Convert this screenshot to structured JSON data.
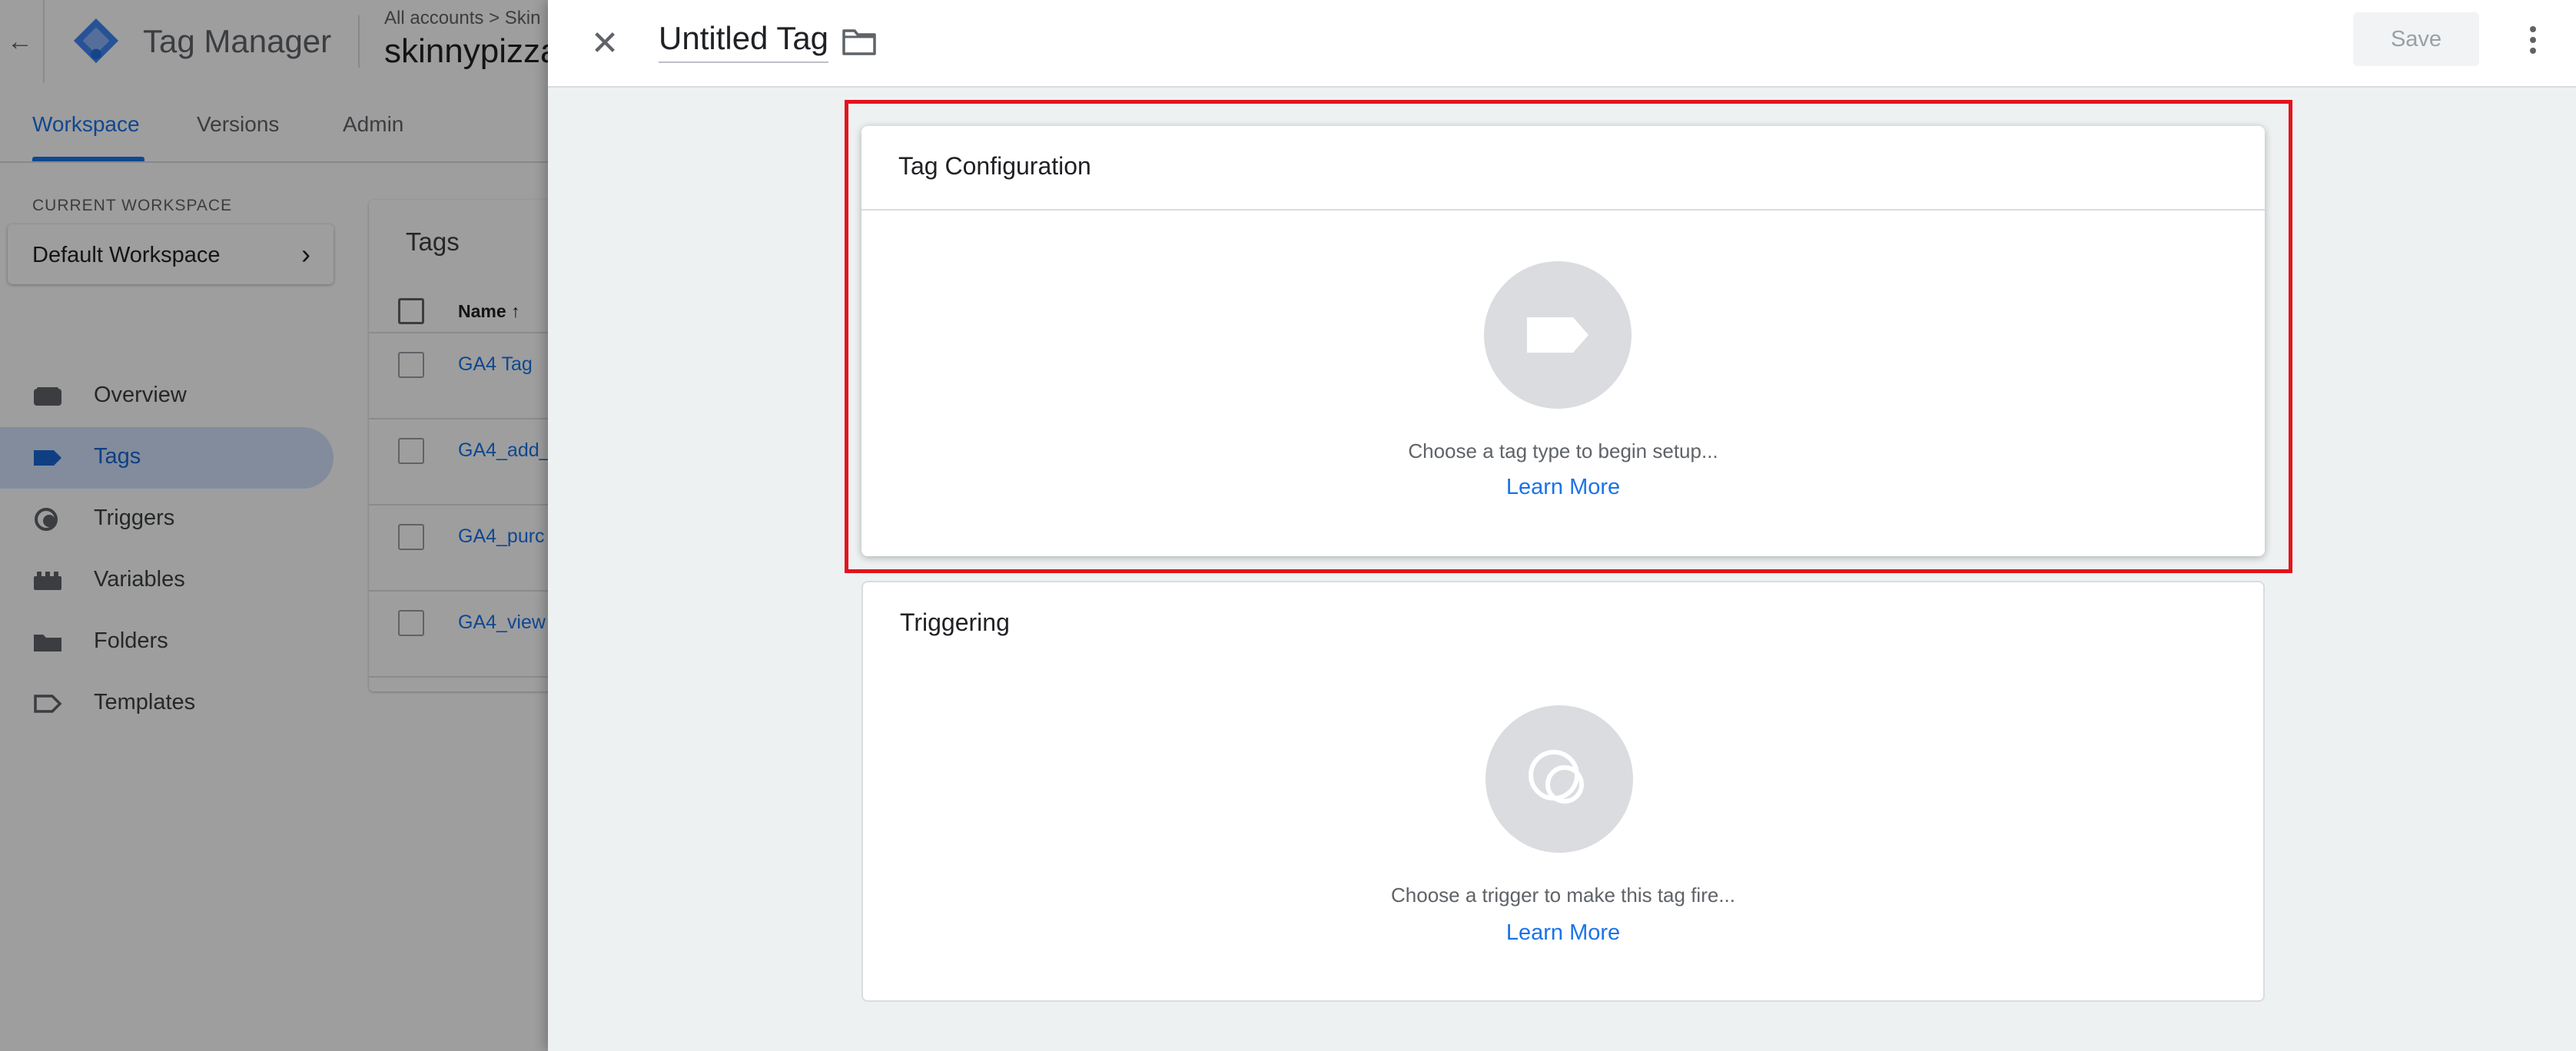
{
  "app": {
    "product_name": "Tag Manager",
    "breadcrumb": "All accounts  >  Skin",
    "container_name": "skinnypizza"
  },
  "tabs": [
    {
      "label": "Workspace",
      "active": true
    },
    {
      "label": "Versions",
      "active": false
    },
    {
      "label": "Admin",
      "active": false
    }
  ],
  "sidebar": {
    "workspace_label": "CURRENT WORKSPACE",
    "workspace_name": "Default Workspace",
    "items": [
      {
        "label": "Overview",
        "icon": "overview-icon",
        "active": false
      },
      {
        "label": "Tags",
        "icon": "tag-icon",
        "active": true
      },
      {
        "label": "Triggers",
        "icon": "trigger-icon",
        "active": false
      },
      {
        "label": "Variables",
        "icon": "variables-icon",
        "active": false
      },
      {
        "label": "Folders",
        "icon": "folder-icon",
        "active": false
      },
      {
        "label": "Templates",
        "icon": "templates-icon",
        "active": false
      }
    ]
  },
  "tags_list": {
    "title": "Tags",
    "column_name": "Name",
    "rows": [
      "GA4 Tag",
      "GA4_add_",
      "GA4_purc",
      "GA4_view"
    ]
  },
  "editor": {
    "tag_name": "Untitled Tag",
    "save_label": "Save",
    "configuration": {
      "title": "Tag Configuration",
      "hint": "Choose a tag type to begin setup...",
      "link": "Learn More"
    },
    "triggering": {
      "title": "Triggering",
      "hint": "Choose a trigger to make this tag fire...",
      "link": "Learn More"
    }
  },
  "colors": {
    "accent": "#1a73e8",
    "highlight": "#e4121c",
    "nav_active_bg": "#d2e3fc"
  }
}
